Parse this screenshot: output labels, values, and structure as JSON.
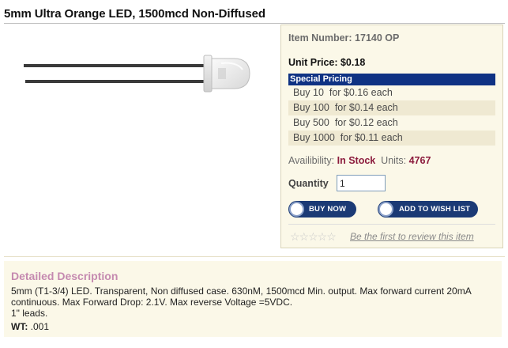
{
  "product": {
    "title": "5mm Ultra Orange LED, 1500mcd Non-Diffused"
  },
  "info": {
    "item_number": "Item Number: 17140 OP",
    "unit_price": "Unit Price: $0.18",
    "special_pricing_header": "Special Pricing",
    "pricing_tiers": [
      "Buy 10  for $0.16 each",
      "Buy 100  for $0.14 each",
      "Buy 500  for $0.12 each",
      "Buy 1000  for $0.11 each"
    ],
    "availability_label": "Availibility: ",
    "availability_value": "In Stock",
    "units_label": "  Units: ",
    "units_value": "4767",
    "quantity_label": "Quantity",
    "quantity_value": "1",
    "buy_now_label": "BUY NOW",
    "wish_list_label": "ADD TO WISH LIST",
    "stars": "☆☆☆☆☆",
    "review_link": "Be the first to review this item"
  },
  "description": {
    "title": "Detailed Description",
    "body": "5mm (T1-3/4) LED. Transparent, Non diffused case. 630nM, 1500mcd Min. output. Max forward current 20mA continuous. Max Forward Drop: 2.1V. Max reverse Voltage =5VDC.",
    "leads": "1\" leads.",
    "wt_label": "WT:",
    "wt_value": " .001"
  },
  "colors": {
    "special_pricing_bg": "#0f3283",
    "stock_accent": "#8b1a3c",
    "panel_bg": "#fbf8e8",
    "description_title": "#c58ab0",
    "button_bg": "#1b3a75"
  },
  "icons": {
    "rating": "star-outline-icon"
  }
}
